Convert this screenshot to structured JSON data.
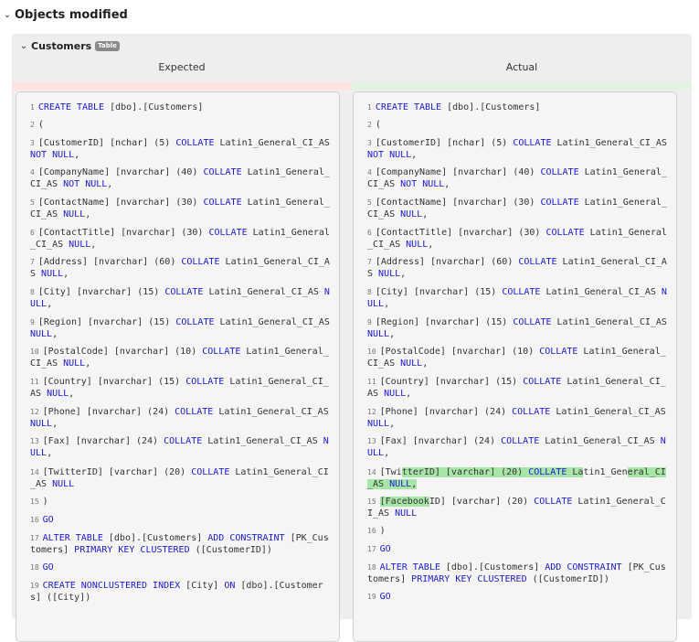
{
  "section": {
    "title": "Objects modified"
  },
  "object": {
    "name": "Customers",
    "badge": "Table"
  },
  "columns": {
    "expected": "Expected",
    "actual": "Actual"
  },
  "colors": {
    "removed": "#fde2e2",
    "added": "#dff5df",
    "highlight": "#a8e6a8",
    "keyword": "#1a1ad6"
  },
  "expected_lines": [
    {
      "n": "1",
      "segs": [
        {
          "t": "CREATE TABLE",
          "k": 1
        },
        {
          "t": " [dbo].[Customers]"
        }
      ]
    },
    {
      "n": "2",
      "segs": [
        {
          "t": "("
        }
      ]
    },
    {
      "n": "3",
      "segs": [
        {
          "t": "[CustomerID] [nchar] (5) "
        },
        {
          "t": "COLLATE",
          "k": 1
        },
        {
          "t": " Latin1_General_CI_AS "
        },
        {
          "t": "NOT NULL",
          "k": 1
        },
        {
          "t": ","
        }
      ]
    },
    {
      "n": "4",
      "segs": [
        {
          "t": "[CompanyName] [nvarchar] (40) "
        },
        {
          "t": "COLLATE",
          "k": 1
        },
        {
          "t": " Latin1_General_CI_AS "
        },
        {
          "t": "NOT NULL",
          "k": 1
        },
        {
          "t": ","
        }
      ]
    },
    {
      "n": "5",
      "segs": [
        {
          "t": "[ContactName] [nvarchar] (30) "
        },
        {
          "t": "COLLATE",
          "k": 1
        },
        {
          "t": " Latin1_General_CI_AS "
        },
        {
          "t": "NULL",
          "k": 1
        },
        {
          "t": ","
        }
      ]
    },
    {
      "n": "6",
      "segs": [
        {
          "t": "[ContactTitle] [nvarchar] (30) "
        },
        {
          "t": "COLLATE",
          "k": 1
        },
        {
          "t": " Latin1_General_CI_AS "
        },
        {
          "t": "NULL",
          "k": 1
        },
        {
          "t": ","
        }
      ]
    },
    {
      "n": "7",
      "segs": [
        {
          "t": "[Address] [nvarchar] (60) "
        },
        {
          "t": "COLLATE",
          "k": 1
        },
        {
          "t": " Latin1_General_CI_AS "
        },
        {
          "t": "NULL",
          "k": 1
        },
        {
          "t": ","
        }
      ]
    },
    {
      "n": "8",
      "segs": [
        {
          "t": "[City] [nvarchar] (15) "
        },
        {
          "t": "COLLATE",
          "k": 1
        },
        {
          "t": " Latin1_General_CI_AS "
        },
        {
          "t": "NULL",
          "k": 1
        },
        {
          "t": ","
        }
      ]
    },
    {
      "n": "9",
      "segs": [
        {
          "t": "[Region] [nvarchar] (15) "
        },
        {
          "t": "COLLATE",
          "k": 1
        },
        {
          "t": " Latin1_General_CI_AS "
        },
        {
          "t": "NULL",
          "k": 1
        },
        {
          "t": ","
        }
      ]
    },
    {
      "n": "10",
      "segs": [
        {
          "t": "[PostalCode] [nvarchar] (10) "
        },
        {
          "t": "COLLATE",
          "k": 1
        },
        {
          "t": " Latin1_General_CI_AS "
        },
        {
          "t": "NULL",
          "k": 1
        },
        {
          "t": ","
        }
      ]
    },
    {
      "n": "11",
      "segs": [
        {
          "t": "[Country] [nvarchar] (15) "
        },
        {
          "t": "COLLATE",
          "k": 1
        },
        {
          "t": " Latin1_General_CI_AS "
        },
        {
          "t": "NULL",
          "k": 1
        },
        {
          "t": ","
        }
      ]
    },
    {
      "n": "12",
      "segs": [
        {
          "t": "[Phone] [nvarchar] (24) "
        },
        {
          "t": "COLLATE",
          "k": 1
        },
        {
          "t": " Latin1_General_CI_AS "
        },
        {
          "t": "NULL",
          "k": 1
        },
        {
          "t": ","
        }
      ]
    },
    {
      "n": "13",
      "segs": [
        {
          "t": "[Fax] [nvarchar] (24) "
        },
        {
          "t": "COLLATE",
          "k": 1
        },
        {
          "t": " Latin1_General_CI_AS "
        },
        {
          "t": "NULL",
          "k": 1
        },
        {
          "t": ","
        }
      ]
    },
    {
      "n": "14",
      "segs": [
        {
          "t": "[TwitterID] [varchar] (20) "
        },
        {
          "t": "COLLATE",
          "k": 1
        },
        {
          "t": " Latin1_General_CI_AS "
        },
        {
          "t": "NULL",
          "k": 1
        }
      ]
    },
    {
      "n": "15",
      "segs": [
        {
          "t": ")"
        }
      ]
    },
    {
      "n": "16",
      "segs": [
        {
          "t": "GO",
          "k": 1
        }
      ]
    },
    {
      "n": "17",
      "segs": [
        {
          "t": "ALTER TABLE",
          "k": 1
        },
        {
          "t": " [dbo].[Customers] "
        },
        {
          "t": "ADD CONSTRAINT",
          "k": 1
        },
        {
          "t": " [PK_Customers] "
        },
        {
          "t": "PRIMARY KEY CLUSTERED",
          "k": 1
        },
        {
          "t": " ([CustomerID])"
        }
      ]
    },
    {
      "n": "18",
      "segs": [
        {
          "t": "GO",
          "k": 1
        }
      ]
    },
    {
      "n": "19",
      "segs": [
        {
          "t": "CREATE NONCLUSTERED INDEX",
          "k": 1
        },
        {
          "t": " [City] "
        },
        {
          "t": "ON",
          "k": 1
        },
        {
          "t": " [dbo].[Customers] ([City])"
        }
      ]
    }
  ],
  "actual_lines": [
    {
      "n": "1",
      "segs": [
        {
          "t": "CREATE TABLE",
          "k": 1
        },
        {
          "t": " [dbo].[Customers]"
        }
      ]
    },
    {
      "n": "2",
      "segs": [
        {
          "t": "("
        }
      ]
    },
    {
      "n": "3",
      "segs": [
        {
          "t": "[CustomerID] [nchar] (5) "
        },
        {
          "t": "COLLATE",
          "k": 1
        },
        {
          "t": " Latin1_General_CI_AS "
        },
        {
          "t": "NOT NULL",
          "k": 1
        },
        {
          "t": ","
        }
      ]
    },
    {
      "n": "4",
      "segs": [
        {
          "t": "[CompanyName] [nvarchar] (40) "
        },
        {
          "t": "COLLATE",
          "k": 1
        },
        {
          "t": " Latin1_General_CI_AS "
        },
        {
          "t": "NOT NULL",
          "k": 1
        },
        {
          "t": ","
        }
      ]
    },
    {
      "n": "5",
      "segs": [
        {
          "t": "[ContactName] [nvarchar] (30) "
        },
        {
          "t": "COLLATE",
          "k": 1
        },
        {
          "t": " Latin1_General_CI_AS "
        },
        {
          "t": "NULL",
          "k": 1
        },
        {
          "t": ","
        }
      ]
    },
    {
      "n": "6",
      "segs": [
        {
          "t": "[ContactTitle] [nvarchar] (30) "
        },
        {
          "t": "COLLATE",
          "k": 1
        },
        {
          "t": " Latin1_General_CI_AS "
        },
        {
          "t": "NULL",
          "k": 1
        },
        {
          "t": ","
        }
      ]
    },
    {
      "n": "7",
      "segs": [
        {
          "t": "[Address] [nvarchar] (60) "
        },
        {
          "t": "COLLATE",
          "k": 1
        },
        {
          "t": " Latin1_General_CI_AS "
        },
        {
          "t": "NULL",
          "k": 1
        },
        {
          "t": ","
        }
      ]
    },
    {
      "n": "8",
      "segs": [
        {
          "t": "[City] [nvarchar] (15) "
        },
        {
          "t": "COLLATE",
          "k": 1
        },
        {
          "t": " Latin1_General_CI_AS "
        },
        {
          "t": "NULL",
          "k": 1
        },
        {
          "t": ","
        }
      ]
    },
    {
      "n": "9",
      "segs": [
        {
          "t": "[Region] [nvarchar] (15) "
        },
        {
          "t": "COLLATE",
          "k": 1
        },
        {
          "t": " Latin1_General_CI_AS "
        },
        {
          "t": "NULL",
          "k": 1
        },
        {
          "t": ","
        }
      ]
    },
    {
      "n": "10",
      "segs": [
        {
          "t": "[PostalCode] [nvarchar] (10) "
        },
        {
          "t": "COLLATE",
          "k": 1
        },
        {
          "t": " Latin1_General_CI_AS "
        },
        {
          "t": "NULL",
          "k": 1
        },
        {
          "t": ","
        }
      ]
    },
    {
      "n": "11",
      "segs": [
        {
          "t": "[Country] [nvarchar] (15) "
        },
        {
          "t": "COLLATE",
          "k": 1
        },
        {
          "t": " Latin1_General_CI_AS "
        },
        {
          "t": "NULL",
          "k": 1
        },
        {
          "t": ","
        }
      ]
    },
    {
      "n": "12",
      "segs": [
        {
          "t": "[Phone] [nvarchar] (24) "
        },
        {
          "t": "COLLATE",
          "k": 1
        },
        {
          "t": " Latin1_General_CI_AS "
        },
        {
          "t": "NULL",
          "k": 1
        },
        {
          "t": ","
        }
      ]
    },
    {
      "n": "13",
      "segs": [
        {
          "t": "[Fax] [nvarchar] (24) "
        },
        {
          "t": "COLLATE",
          "k": 1
        },
        {
          "t": " Latin1_General_CI_AS "
        },
        {
          "t": "NULL",
          "k": 1
        },
        {
          "t": ","
        }
      ]
    },
    {
      "n": "14",
      "segs": [
        {
          "t": "[Twi"
        },
        {
          "t": "tterID] [varchar] (20) ",
          "h": 1
        },
        {
          "t": "COLLATE",
          "k": 1,
          "h": 1
        },
        {
          "t": " La",
          "h": 1
        },
        {
          "t": "tin1_Gen"
        },
        {
          "t": "eral_CI_AS ",
          "h": 1
        },
        {
          "t": "NULL",
          "k": 1,
          "h": 1
        },
        {
          "t": ",",
          "h": 1
        }
      ]
    },
    {
      "n": "15",
      "segs": [
        {
          "t": "[Facebook",
          "h": 1
        },
        {
          "t": "ID] [varchar] (20) "
        },
        {
          "t": "COLLATE",
          "k": 1
        },
        {
          "t": " Latin1_General_CI_AS "
        },
        {
          "t": "NULL",
          "k": 1
        }
      ]
    },
    {
      "n": "16",
      "segs": [
        {
          "t": ")"
        }
      ]
    },
    {
      "n": "17",
      "segs": [
        {
          "t": "GO",
          "k": 1
        }
      ]
    },
    {
      "n": "18",
      "segs": [
        {
          "t": "ALTER TABLE",
          "k": 1
        },
        {
          "t": " [dbo].[Customers] "
        },
        {
          "t": "ADD CONSTRAINT",
          "k": 1
        },
        {
          "t": " [PK_Customers] "
        },
        {
          "t": "PRIMARY KEY CLUSTERED",
          "k": 1
        },
        {
          "t": " ([CustomerID])"
        }
      ]
    },
    {
      "n": "19",
      "segs": [
        {
          "t": "GO",
          "k": 1
        }
      ]
    }
  ]
}
